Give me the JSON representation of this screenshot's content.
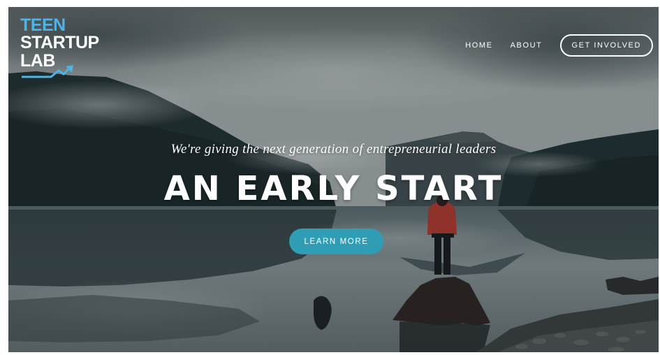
{
  "logo": {
    "line1": "TEEN",
    "line2": "STARTUP",
    "line3": "LAB",
    "colors": {
      "teen": "#4fb3e3",
      "text": "#ffffff",
      "arrow": "#4fb3e3"
    },
    "arrow_icon": "trending-up-arrow"
  },
  "nav": {
    "items": [
      {
        "label": "HOME"
      },
      {
        "label": "ABOUT"
      }
    ],
    "cta": "GET INVOLVED"
  },
  "hero": {
    "tagline": "We're giving the next generation of entrepreneurial leaders",
    "headline": "AN EARLY START",
    "button": "LEARN MORE",
    "button_color": "#2f9db3",
    "image": "misty mountain lake with person in red jacket standing on tree stump"
  }
}
